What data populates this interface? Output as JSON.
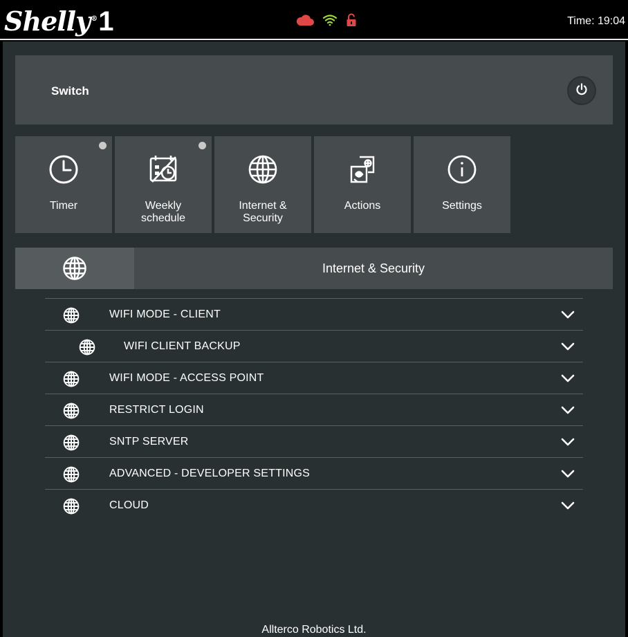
{
  "header": {
    "logo_text": "Shelly",
    "logo_reg": "®",
    "logo_number": "1",
    "time_text": "Time: 19:04",
    "status_icons": [
      {
        "name": "cloud-icon",
        "color": "#e04848"
      },
      {
        "name": "wifi-icon",
        "color": "#9fd63a"
      },
      {
        "name": "lock-open-icon",
        "color": "#e04848"
      }
    ]
  },
  "switch": {
    "label": "Switch",
    "icon": "power-icon"
  },
  "tiles": [
    {
      "label": "Timer",
      "icon": "clock-icon",
      "dot": true
    },
    {
      "label": "Weekly schedule",
      "icon": "calendar-icon",
      "dot": true
    },
    {
      "label": "Internet & Security",
      "icon": "globe-icon",
      "dot": false
    },
    {
      "label": "Actions",
      "icon": "actions-icon",
      "dot": false
    },
    {
      "label": "Settings",
      "icon": "info-icon",
      "dot": false
    }
  ],
  "section": {
    "title": "Internet & Security",
    "icon": "globe-icon"
  },
  "settings_list": [
    {
      "label": "WIFI MODE - CLIENT",
      "sub": false
    },
    {
      "label": "WIFI CLIENT BACKUP",
      "sub": true
    },
    {
      "label": "WIFI MODE - ACCESS POINT",
      "sub": false
    },
    {
      "label": "RESTRICT LOGIN",
      "sub": false
    },
    {
      "label": "SNTP SERVER",
      "sub": false
    },
    {
      "label": "ADVANCED - DEVELOPER SETTINGS",
      "sub": false
    },
    {
      "label": "CLOUD",
      "sub": false
    }
  ],
  "footer": {
    "text": "Allterco Robotics Ltd."
  },
  "colors": {
    "background": "#283032",
    "card": "#464b4d",
    "accent_red": "#e04848",
    "accent_green": "#9fd63a"
  }
}
